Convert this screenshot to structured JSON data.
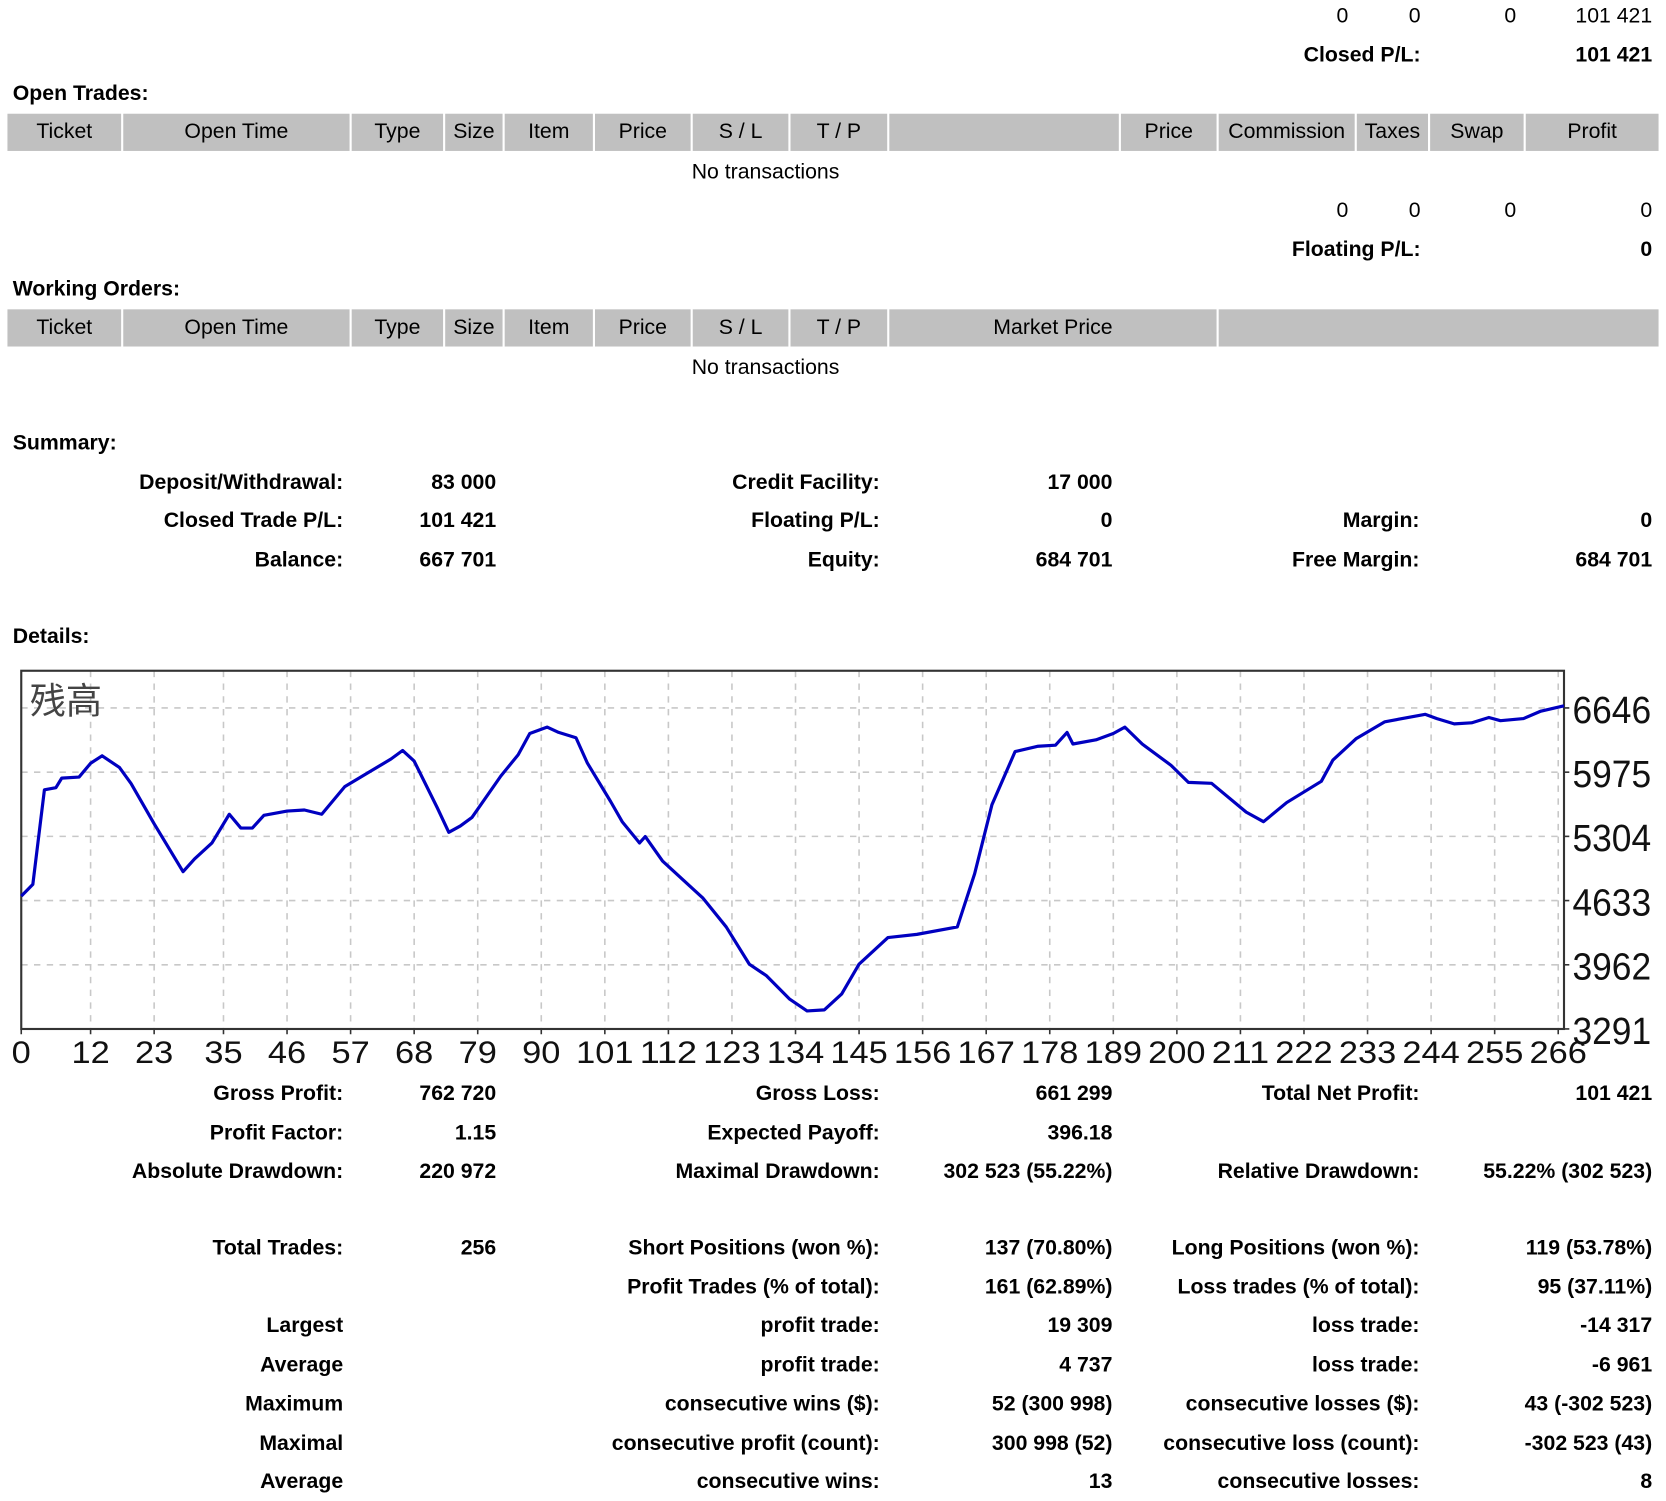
{
  "closed_trades_totals": {
    "commission": "0",
    "taxes": "0",
    "swap": "0",
    "profit": "101 421",
    "closed_pl_label": "Closed P/L:",
    "closed_pl_value": "101 421"
  },
  "open_trades": {
    "title": "Open Trades:",
    "columns": [
      "Ticket",
      "Open Time",
      "Type",
      "Size",
      "Item",
      "Price",
      "S / L",
      "T / P",
      "",
      "Price",
      "Commission",
      "Taxes",
      "Swap",
      "Profit"
    ],
    "empty_text": "No transactions",
    "totals": {
      "commission": "0",
      "taxes": "0",
      "swap": "0",
      "profit": "0"
    },
    "floating_pl_label": "Floating P/L:",
    "floating_pl_value": "0"
  },
  "working_orders": {
    "title": "Working Orders:",
    "columns": [
      "Ticket",
      "Open Time",
      "Type",
      "Size",
      "Item",
      "Price",
      "S / L",
      "T / P",
      "Market Price",
      ""
    ],
    "empty_text": "No transactions"
  },
  "summary": {
    "title": "Summary:",
    "rows": [
      [
        {
          "l": "Deposit/Withdrawal:",
          "v": "83 000"
        },
        {
          "l": "Credit Facility:",
          "v": "17 000"
        },
        {
          "l": "",
          "v": ""
        }
      ],
      [
        {
          "l": "Closed Trade P/L:",
          "v": "101 421"
        },
        {
          "l": "Floating P/L:",
          "v": "0"
        },
        {
          "l": "Margin:",
          "v": "0"
        }
      ],
      [
        {
          "l": "Balance:",
          "v": "667 701"
        },
        {
          "l": "Equity:",
          "v": "684 701"
        },
        {
          "l": "Free Margin:",
          "v": "684 701"
        }
      ]
    ]
  },
  "details": {
    "title": "Details:",
    "rows": [
      [
        {
          "l": "Gross Profit:",
          "v": "762 720"
        },
        {
          "l": "Gross Loss:",
          "v": "661 299"
        },
        {
          "l": "Total Net Profit:",
          "v": "101 421"
        }
      ],
      [
        {
          "l": "Profit Factor:",
          "v": "1.15"
        },
        {
          "l": "Expected Payoff:",
          "v": "396.18"
        },
        {
          "l": "",
          "v": ""
        }
      ],
      [
        {
          "l": "Absolute Drawdown:",
          "v": "220 972"
        },
        {
          "l": "Maximal Drawdown:",
          "v": "302 523 (55.22%)"
        },
        {
          "l": "Relative Drawdown:",
          "v": "55.22% (302 523)"
        }
      ],
      [
        {
          "l": "Total Trades:",
          "v": "256"
        },
        {
          "l": "Short Positions (won %):",
          "v": "137 (70.80%)"
        },
        {
          "l": "Long Positions (won %):",
          "v": "119 (53.78%)"
        }
      ],
      [
        {
          "l": "",
          "v": ""
        },
        {
          "l": "Profit Trades (% of total):",
          "v": "161 (62.89%)"
        },
        {
          "l": "Loss trades (% of total):",
          "v": "95 (37.11%)"
        }
      ],
      [
        {
          "l": "Largest",
          "v": ""
        },
        {
          "l": "profit trade:",
          "v": "19 309"
        },
        {
          "l": "loss trade:",
          "v": "-14 317"
        }
      ],
      [
        {
          "l": "Average",
          "v": ""
        },
        {
          "l": "profit trade:",
          "v": "4 737"
        },
        {
          "l": "loss trade:",
          "v": "-6 961"
        }
      ],
      [
        {
          "l": "Maximum",
          "v": ""
        },
        {
          "l": "consecutive wins ($):",
          "v": "52 (300 998)"
        },
        {
          "l": "consecutive losses ($):",
          "v": "43 (-302 523)"
        }
      ],
      [
        {
          "l": "Maximal",
          "v": ""
        },
        {
          "l": "consecutive profit (count):",
          "v": "300 998 (52)"
        },
        {
          "l": "consecutive loss (count):",
          "v": "-302 523 (43)"
        }
      ],
      [
        {
          "l": "Average",
          "v": ""
        },
        {
          "l": "consecutive wins:",
          "v": "13"
        },
        {
          "l": "consecutive losses:",
          "v": "8"
        }
      ]
    ]
  },
  "chart_data": {
    "type": "line",
    "title": "残高",
    "line_color": "#0000c0",
    "grid": true,
    "xlim": [
      0,
      267
    ],
    "ylim": [
      3291,
      7035
    ],
    "x_ticks": [
      "0",
      "12",
      "23",
      "35",
      "46",
      "57",
      "68",
      "79",
      "90",
      "101",
      "112",
      "123",
      "134",
      "145",
      "156",
      "167",
      "178",
      "189",
      "200",
      "211",
      "222",
      "233",
      "244",
      "255",
      "266"
    ],
    "y_ticks": [
      "3291",
      "3962",
      "4633",
      "5304",
      "5975",
      "6646"
    ],
    "x": [
      0,
      2,
      4,
      6,
      7,
      10,
      12,
      14,
      17,
      19,
      23,
      28,
      30,
      33,
      36,
      38,
      40,
      42,
      46,
      49,
      52,
      56,
      60,
      64,
      66,
      68,
      72,
      74,
      76,
      78,
      83,
      86,
      88,
      91,
      93,
      96,
      98,
      102,
      104,
      107,
      108,
      111,
      118,
      122,
      126,
      129,
      133,
      136,
      139,
      142,
      145,
      150,
      155,
      162,
      165,
      168,
      172,
      176,
      179,
      181,
      182,
      186,
      189,
      191,
      194,
      199,
      202,
      206,
      212,
      215,
      219,
      225,
      227,
      231,
      236,
      243,
      245,
      248,
      251,
      254,
      256,
      260,
      263,
      267
    ],
    "y": [
      4680,
      4802,
      5791,
      5813,
      5913,
      5924,
      6069,
      6146,
      6024,
      5857,
      5435,
      4935,
      5069,
      5235,
      5535,
      5391,
      5391,
      5524,
      5569,
      5580,
      5535,
      5824,
      5969,
      6113,
      6202,
      6091,
      5602,
      5346,
      5413,
      5502,
      5935,
      6157,
      6380,
      6446,
      6391,
      6335,
      6069,
      5669,
      5457,
      5235,
      5302,
      5046,
      4658,
      4358,
      3969,
      3847,
      3602,
      3480,
      3491,
      3658,
      3969,
      4246,
      4280,
      4358,
      4913,
      5635,
      6191,
      6246,
      6257,
      6391,
      6269,
      6313,
      6380,
      6446,
      6269,
      6046,
      5869,
      5858,
      5557,
      5457,
      5657,
      5880,
      6102,
      6324,
      6502,
      6580,
      6535,
      6480,
      6491,
      6546,
      6513,
      6535,
      6613,
      6668
    ]
  }
}
